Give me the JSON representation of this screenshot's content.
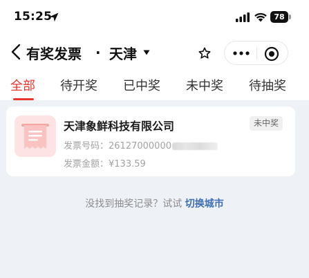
{
  "status_bar": {
    "time": "15:25",
    "battery": "78",
    "icons": [
      "location-arrow-icon",
      "signal-icon",
      "wifi-icon",
      "battery-icon"
    ]
  },
  "nav": {
    "title": "有奖发票",
    "separator": "·",
    "city": "天津",
    "icons": [
      "back-icon",
      "chevron-down-icon",
      "star-icon",
      "more-icon",
      "target-icon"
    ]
  },
  "tabs": [
    {
      "label": "全部",
      "active": true
    },
    {
      "label": "待开奖",
      "active": false
    },
    {
      "label": "已中奖",
      "active": false
    },
    {
      "label": "未中奖",
      "active": false
    },
    {
      "label": "待抽奖",
      "active": false
    }
  ],
  "card": {
    "company": "天津象鲜科技有限公司",
    "status": "未中奖",
    "invoice_no_label": "发票号码：",
    "invoice_no_value": "26127000000",
    "amount_label": "发票金额：",
    "amount_value": "¥133.59"
  },
  "hint": {
    "text": "没找到抽奖记录？试试",
    "link": "切换城市"
  },
  "colors": {
    "accent": "#e8352e",
    "link": "#3d6fb0",
    "background": "#eef1f6",
    "thumb_bg": "#fde3e3"
  }
}
